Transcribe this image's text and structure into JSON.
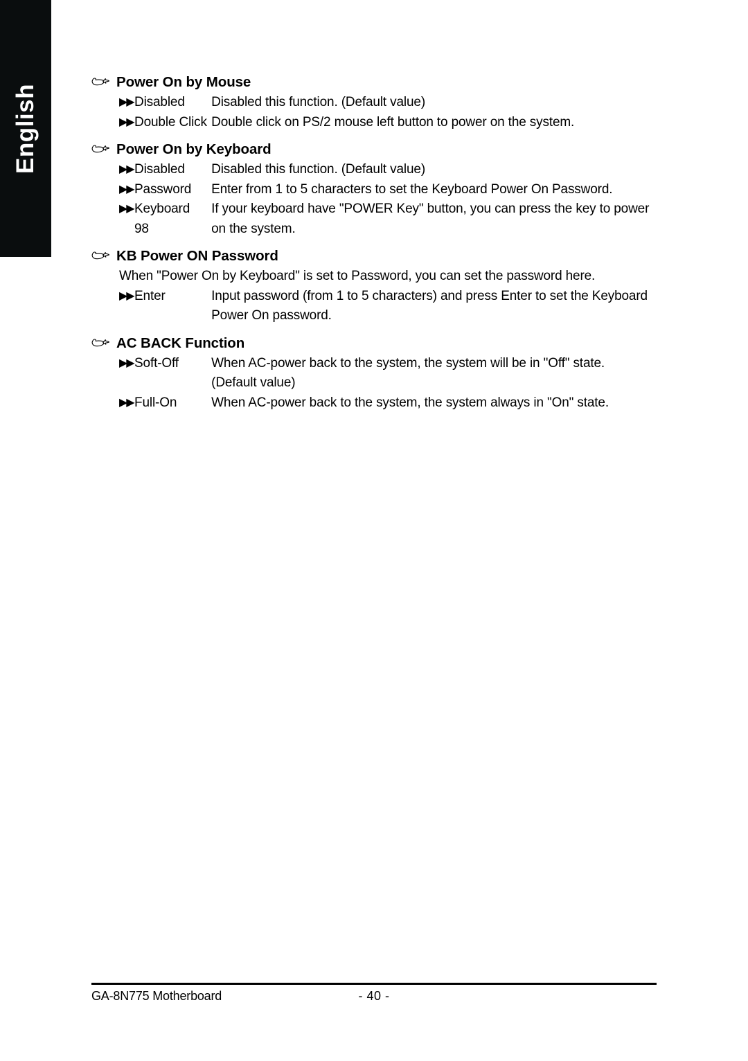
{
  "page": {
    "language_tab": "English",
    "accent_color": "#0a0d0e",
    "background_color": "#ffffff"
  },
  "icons": {
    "heading_bullet": "pointing-hand-icon",
    "option_bullet": "▶▶"
  },
  "sections": [
    {
      "id": "power-on-by-mouse",
      "heading": "Power On by Mouse",
      "options": [
        {
          "label": "Disabled",
          "desc": "Disabled this function. (Default value)",
          "desc_cont": ""
        },
        {
          "label": "Double Click",
          "desc": "Double click on PS/2 mouse left button to power on the system.",
          "desc_cont": ""
        }
      ]
    },
    {
      "id": "power-on-by-keyboard",
      "heading": "Power On by Keyboard",
      "options": [
        {
          "label": "Disabled",
          "desc": "Disabled this function. (Default value)",
          "desc_cont": ""
        },
        {
          "label": "Password",
          "desc": "Enter from 1 to 5 characters to set the Keyboard Power On Password.",
          "desc_cont": ""
        },
        {
          "label": "Keyboard 98",
          "desc": "If your keyboard have \"POWER Key\" button, you can press the key to power",
          "desc_cont": "on the system."
        }
      ]
    },
    {
      "id": "kb-power-on-password",
      "heading": "KB Power ON Password",
      "intro": "When \"Power On by Keyboard\" is set to Password, you can set the password here.",
      "options": [
        {
          "label": "Enter",
          "desc": "Input password (from 1 to 5 characters) and press Enter to set the Keyboard",
          "desc_cont": "Power On password."
        }
      ]
    },
    {
      "id": "ac-back-function",
      "heading": "AC BACK Function",
      "options": [
        {
          "label": "Soft-Off",
          "desc": "When AC-power back to the system, the system will be in \"Off\" state.",
          "desc_cont": "(Default value)"
        },
        {
          "label": "Full-On",
          "desc": "When AC-power back to the system, the system always in \"On\" state.",
          "desc_cont": ""
        }
      ]
    }
  ],
  "footer": {
    "left": "GA-8N775 Motherboard",
    "page_number": "- 40 -"
  }
}
